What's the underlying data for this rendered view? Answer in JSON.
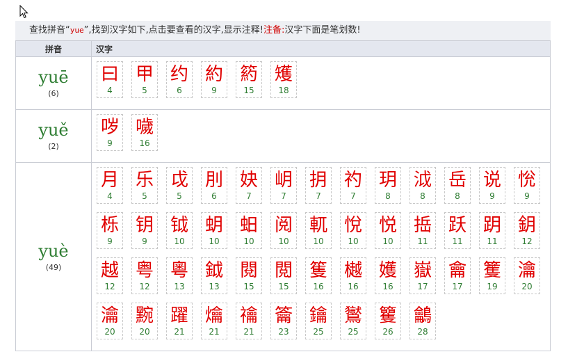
{
  "info": {
    "prefix": "查找拼音“",
    "keyword": "yue",
    "middle": "”,找到汉字如下,点击要查看的汉字,显示注释!",
    "note_label": "注备:",
    "note_text": "汉字下面是笔划数!"
  },
  "table": {
    "col_pinyin": "拼音",
    "col_chars": "汉字"
  },
  "groups": [
    {
      "pinyin": "yuē",
      "count": "(6)",
      "chars": [
        {
          "c": "曰",
          "s": "4"
        },
        {
          "c": "甲",
          "s": "5"
        },
        {
          "c": "约",
          "s": "6"
        },
        {
          "c": "約",
          "s": "9"
        },
        {
          "c": "箹",
          "s": "15"
        },
        {
          "c": "矱",
          "s": "18"
        }
      ]
    },
    {
      "pinyin": "yuě",
      "count": "(2)",
      "chars": [
        {
          "c": "哕",
          "s": "9"
        },
        {
          "c": "噦",
          "s": "16"
        }
      ]
    },
    {
      "pinyin": "yuè",
      "count": "(49)",
      "chars": [
        {
          "c": "月",
          "s": "4"
        },
        {
          "c": "乐",
          "s": "5"
        },
        {
          "c": "戉",
          "s": "5"
        },
        {
          "c": "刖",
          "s": "6"
        },
        {
          "c": "妜",
          "s": "7"
        },
        {
          "c": "岄",
          "s": "7"
        },
        {
          "c": "抈",
          "s": "7"
        },
        {
          "c": "礿",
          "s": "7"
        },
        {
          "c": "玥",
          "s": "8"
        },
        {
          "c": "泧",
          "s": "8"
        },
        {
          "c": "岳",
          "s": "8"
        },
        {
          "c": "说",
          "s": "9"
        },
        {
          "c": "恱",
          "s": "9"
        },
        {
          "c": "栎",
          "s": "9"
        },
        {
          "c": "钥",
          "s": "9"
        },
        {
          "c": "钺",
          "s": "10"
        },
        {
          "c": "蚏",
          "s": "10"
        },
        {
          "c": "蚎",
          "s": "10"
        },
        {
          "c": "阅",
          "s": "10"
        },
        {
          "c": "軏",
          "s": "10"
        },
        {
          "c": "悅",
          "s": "10"
        },
        {
          "c": "悦",
          "s": "10"
        },
        {
          "c": "捳",
          "s": "11"
        },
        {
          "c": "跃",
          "s": "11"
        },
        {
          "c": "跀",
          "s": "11"
        },
        {
          "c": "鈅",
          "s": "12"
        },
        {
          "c": "越",
          "s": "12"
        },
        {
          "c": "粤",
          "s": "12"
        },
        {
          "c": "粵",
          "s": "13"
        },
        {
          "c": "鉞",
          "s": "13"
        },
        {
          "c": "閱",
          "s": "15"
        },
        {
          "c": "閲",
          "s": "15"
        },
        {
          "c": "篗",
          "s": "16"
        },
        {
          "c": "樾",
          "s": "16"
        },
        {
          "c": "嬳",
          "s": "16"
        },
        {
          "c": "嶽",
          "s": "17"
        },
        {
          "c": "龠",
          "s": "17"
        },
        {
          "c": "籆",
          "s": "19"
        },
        {
          "c": "瀹",
          "s": "20"
        },
        {
          "c": "瀹",
          "s": "20"
        },
        {
          "c": "黦",
          "s": "20"
        },
        {
          "c": "躍",
          "s": "21"
        },
        {
          "c": "爚",
          "s": "21"
        },
        {
          "c": "禴",
          "s": "21"
        },
        {
          "c": "籥",
          "s": "23"
        },
        {
          "c": "鑰",
          "s": "25"
        },
        {
          "c": "鸑",
          "s": "25"
        },
        {
          "c": "籰",
          "s": "26"
        },
        {
          "c": "鸙",
          "s": "28"
        }
      ]
    }
  ]
}
